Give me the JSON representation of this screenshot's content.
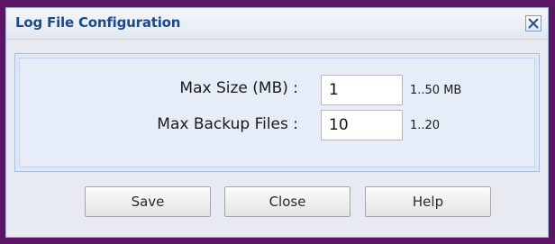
{
  "dialog": {
    "title": "Log File Configuration",
    "close_icon": "close-icon"
  },
  "form": {
    "max_size": {
      "label": "Max Size (MB) :",
      "value": "1",
      "range": "1..50 MB"
    },
    "max_backup": {
      "label": "Max Backup Files :",
      "value": "10",
      "range": "1..20"
    }
  },
  "buttons": {
    "save": "Save",
    "close": "Close",
    "help": "Help"
  },
  "colors": {
    "window_frame": "#5b1466",
    "title_text": "#1d4a8a",
    "dialog_bg": "#e7eaf0",
    "panel_bg": "#e6edf8"
  }
}
